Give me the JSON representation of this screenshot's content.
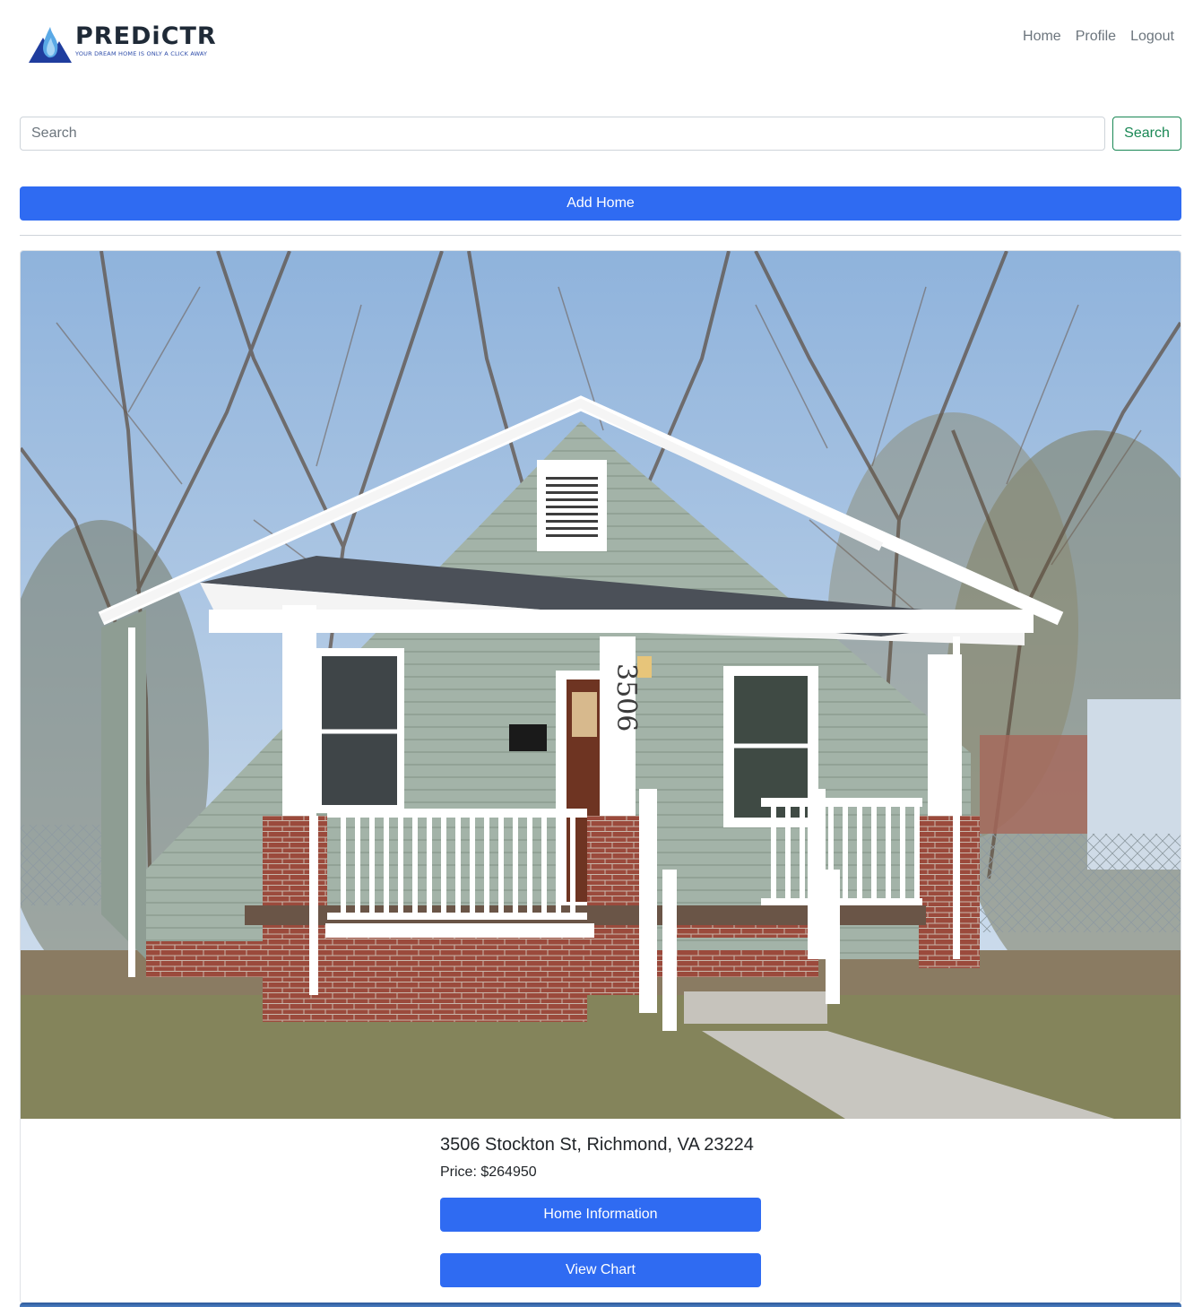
{
  "brand": {
    "name": "PREDiCTR",
    "tagline": "YOUR DREAM HOME IS ONLY A CLICK AWAY"
  },
  "nav": {
    "links": [
      "Home",
      "Profile",
      "Logout"
    ]
  },
  "search": {
    "placeholder": "Search",
    "value": "",
    "button_label": "Search"
  },
  "actions": {
    "add_home_label": "Add Home"
  },
  "listings": [
    {
      "photo_house_number": "3506",
      "address": "3506 Stockton St, Richmond, VA 23224",
      "price_label": "Price:",
      "price_value": "$264950",
      "info_button_label": "Home Information",
      "chart_button_label": "View Chart"
    }
  ],
  "colors": {
    "primary": "#2f6bf2",
    "success": "#198754",
    "muted": "#6c757d",
    "siding": "#9fb0a4",
    "brick": "#9b4a3c"
  }
}
